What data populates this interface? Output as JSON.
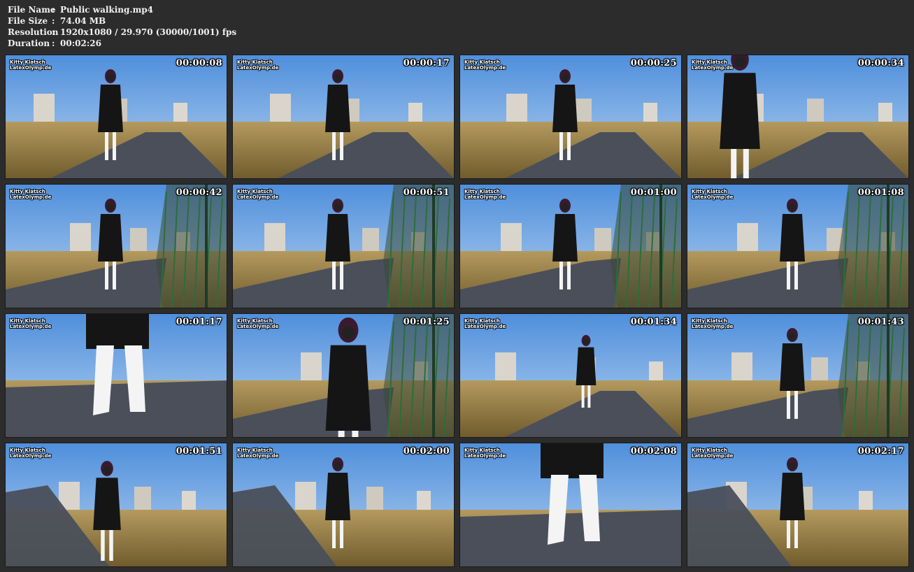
{
  "header": {
    "rows": [
      {
        "label": "File Name",
        "sep": ":",
        "value": "Public walking.mp4"
      },
      {
        "label": "File Size",
        "sep": ":",
        "value": "74.04 MB"
      },
      {
        "label": "Resolution",
        "sep": ":",
        "value": "1920x1080 / 29.970 (30000/1001) fps"
      },
      {
        "label": "Duration",
        "sep": ":",
        "value": "00:02:26"
      }
    ]
  },
  "watermark": {
    "line1": "Kitty Klatsch",
    "line2": "LatexOlymp.de"
  },
  "thumbnails": [
    {
      "timestamp": "00:00:08",
      "scene": "sidewalk-buildings"
    },
    {
      "timestamp": "00:00:17",
      "scene": "field-buildings"
    },
    {
      "timestamp": "00:00:25",
      "scene": "road-bollard"
    },
    {
      "timestamp": "00:00:34",
      "scene": "closeup-fence"
    },
    {
      "timestamp": "00:00:42",
      "scene": "fence-path"
    },
    {
      "timestamp": "00:00:51",
      "scene": "fence-path"
    },
    {
      "timestamp": "00:01:00",
      "scene": "fence-path"
    },
    {
      "timestamp": "00:01:08",
      "scene": "fence-path"
    },
    {
      "timestamp": "00:01:17",
      "scene": "boots-closeup"
    },
    {
      "timestamp": "00:01:25",
      "scene": "portrait-fence"
    },
    {
      "timestamp": "00:01:34",
      "scene": "shadow-path"
    },
    {
      "timestamp": "00:01:43",
      "scene": "fence-path"
    },
    {
      "timestamp": "00:01:51",
      "scene": "street-trees"
    },
    {
      "timestamp": "00:02:00",
      "scene": "path-grass"
    },
    {
      "timestamp": "00:02:08",
      "scene": "boots-closeup"
    },
    {
      "timestamp": "00:02:17",
      "scene": "path-grass"
    }
  ],
  "colors": {
    "background": "#2c2c2c",
    "header_text": "#f2f2f2",
    "sky": "#7fb0e6",
    "grass": "#9c7f45",
    "road": "#4a4f5a",
    "coat": "#151515",
    "boots": "#f4f4f4",
    "fence": "#2d6d3a"
  }
}
